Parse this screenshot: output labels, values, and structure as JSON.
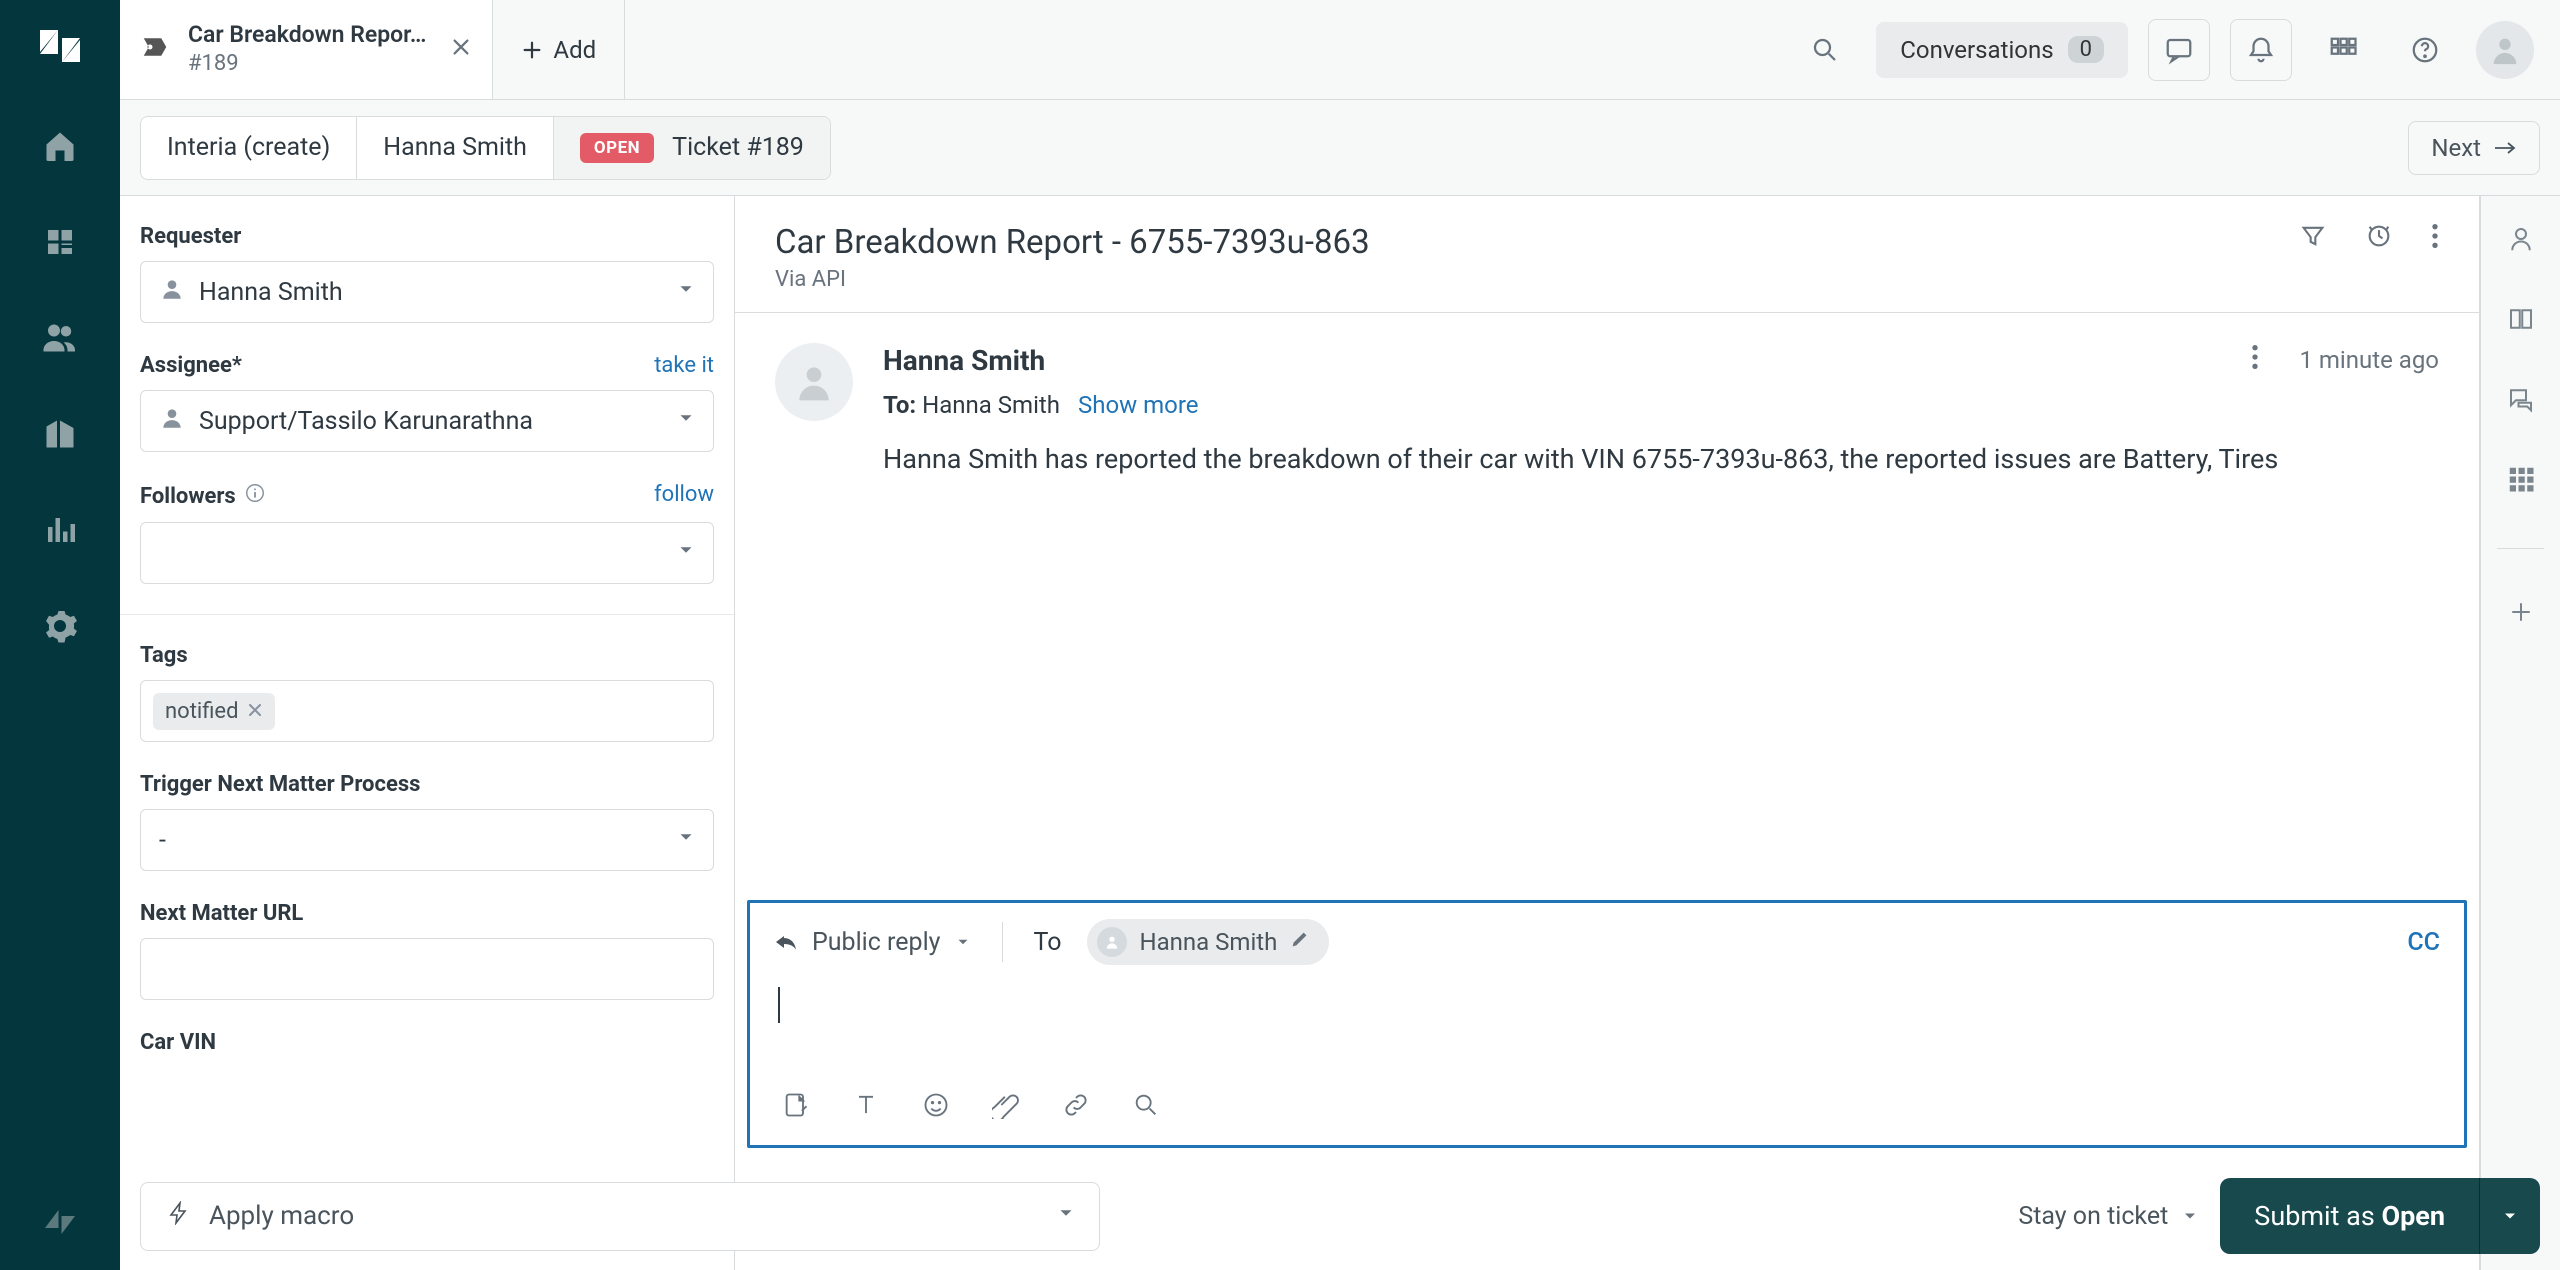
{
  "tab": {
    "title": "Car Breakdown Repor…",
    "sub": "#189",
    "add_label": "Add"
  },
  "topbar": {
    "conversations_label": "Conversations",
    "conversations_count": "0"
  },
  "crumb": {
    "org": "Interia (create)",
    "person": "Hanna Smith",
    "status": "OPEN",
    "ticket": "Ticket #189",
    "next": "Next"
  },
  "panel": {
    "requester_label": "Requester",
    "requester_value": "Hanna Smith",
    "assignee_label": "Assignee*",
    "assignee_value": "Support/Tassilo Karunarathna",
    "take_it": "take it",
    "followers_label": "Followers",
    "follow": "follow",
    "tags_label": "Tags",
    "tag1": "notified",
    "trigger_label": "Trigger Next Matter Process",
    "trigger_value": "-",
    "url_label": "Next Matter URL",
    "vin_label": "Car VIN"
  },
  "convo": {
    "title": "Car Breakdown Report - 6755-7393u-863",
    "via": "Via API",
    "msg_author": "Hanna Smith",
    "msg_time": "1 minute ago",
    "msg_to_label": "To:",
    "msg_to_value": "Hanna Smith",
    "show_more": "Show more",
    "msg_body": "Hanna Smith has reported the breakdown of their car with VIN 6755-7393u-863, the reported issues are Battery, Tires"
  },
  "composer": {
    "reply_mode": "Public reply",
    "to_label": "To",
    "to_chip": "Hanna Smith",
    "cc": "CC"
  },
  "footer": {
    "macro": "Apply macro",
    "stay": "Stay on ticket",
    "submit_prefix": "Submit as ",
    "submit_status": "Open"
  }
}
